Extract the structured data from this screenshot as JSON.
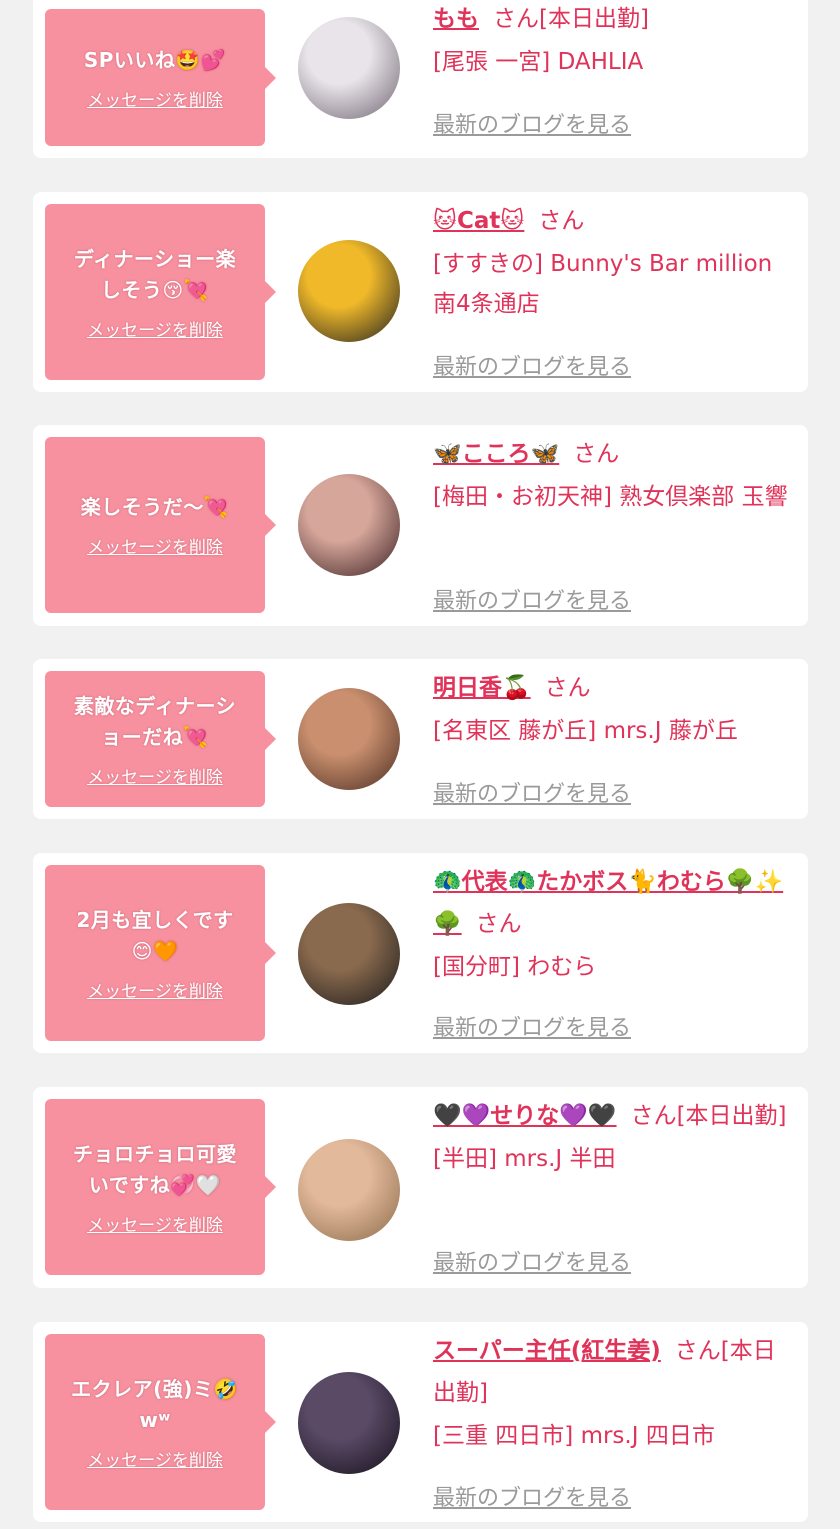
{
  "messages": [
    {
      "bubble": "SPいいね🤩💕",
      "delete_label": "メッセージを削除",
      "name": "もも",
      "suffix": "さん[本日出勤]",
      "shop": "[尾張 一宮] DAHLIA",
      "blog_label": "最新のブログを見る",
      "avatar_colors": [
        "#e9e3ea",
        "#6e6670"
      ]
    },
    {
      "bubble": "ディナーショー楽\nしそう😚💘",
      "delete_label": "メッセージを削除",
      "name": "🐱Cat🐱",
      "suffix": "さん",
      "shop": "[すすきの] Bunny's Bar million 南4条通店",
      "blog_label": "最新のブログを見る",
      "avatar_colors": [
        "#f0b92a",
        "#1f1f1f"
      ]
    },
    {
      "bubble": "楽しそうだ〜💘",
      "delete_label": "メッセージを削除",
      "name": "🦋こころ🦋",
      "suffix": "さん",
      "shop": "[梅田・お初天神] 熟女倶楽部 玉響",
      "blog_label": "最新のブログを見る",
      "avatar_colors": [
        "#d6a69a",
        "#3a1f22"
      ]
    },
    {
      "bubble": "素敵なディナーシ\nョーだね💘",
      "delete_label": "メッセージを削除",
      "name": "明日香🍒",
      "suffix": "さん",
      "shop": "[名東区 藤が丘] mrs.J 藤が丘",
      "blog_label": "最新のブログを見る",
      "avatar_colors": [
        "#c98f6e",
        "#4a2c20"
      ]
    },
    {
      "bubble": "2月も宜しくです\n😊🧡",
      "delete_label": "メッセージを削除",
      "name": "🦚代表🦚たかボス🐈わむら🌳✨🌳",
      "suffix": "さん",
      "shop": "[国分町] わむら",
      "blog_label": "最新のブログを見る",
      "avatar_colors": [
        "#8a6a4e",
        "#1a1a1a"
      ]
    },
    {
      "bubble": "チョロチョロ可愛\nいですね💞🤍",
      "delete_label": "メッセージを削除",
      "name": "🖤💜せりな💜🖤",
      "suffix": "さん[本日出勤]",
      "shop": "[半田] mrs.J 半田",
      "blog_label": "最新のブログを見る",
      "avatar_colors": [
        "#e2b99a",
        "#8a6a4a"
      ]
    },
    {
      "bubble": "エクレア(強)ミ🤣\nwʷ",
      "delete_label": "メッセージを削除",
      "name": "スーパー主任(紅生姜)",
      "suffix": "さん[本日出勤]",
      "shop": "[三重 四日市] mrs.J 四日市",
      "blog_label": "最新のブログを見る",
      "avatar_colors": [
        "#5a4a66",
        "#140f1a"
      ]
    }
  ]
}
